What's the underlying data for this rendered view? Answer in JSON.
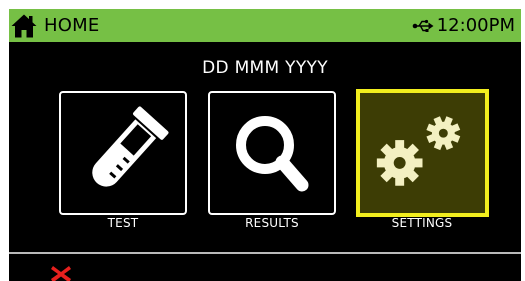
{
  "header": {
    "home_label": "HOME",
    "time": "12:00PM",
    "home_icon": "home-icon",
    "usb_icon": "usb-icon"
  },
  "date_text": "DD MMM YYYY",
  "menu": {
    "tiles": [
      {
        "label": "TEST",
        "icon": "test-tube-icon",
        "selected": false
      },
      {
        "label": "RESULTS",
        "icon": "magnifier-icon",
        "selected": false
      },
      {
        "label": "SETTINGS",
        "icon": "gears-icon",
        "selected": true
      }
    ]
  },
  "footer": {
    "close_icon": "close-icon"
  },
  "colors": {
    "status_bar": "#76c045",
    "selected_border": "#f2ee1e",
    "selected_fill": "#3d3d05",
    "gear_fill": "#f3f0c2",
    "close_red": "#e8201e"
  }
}
